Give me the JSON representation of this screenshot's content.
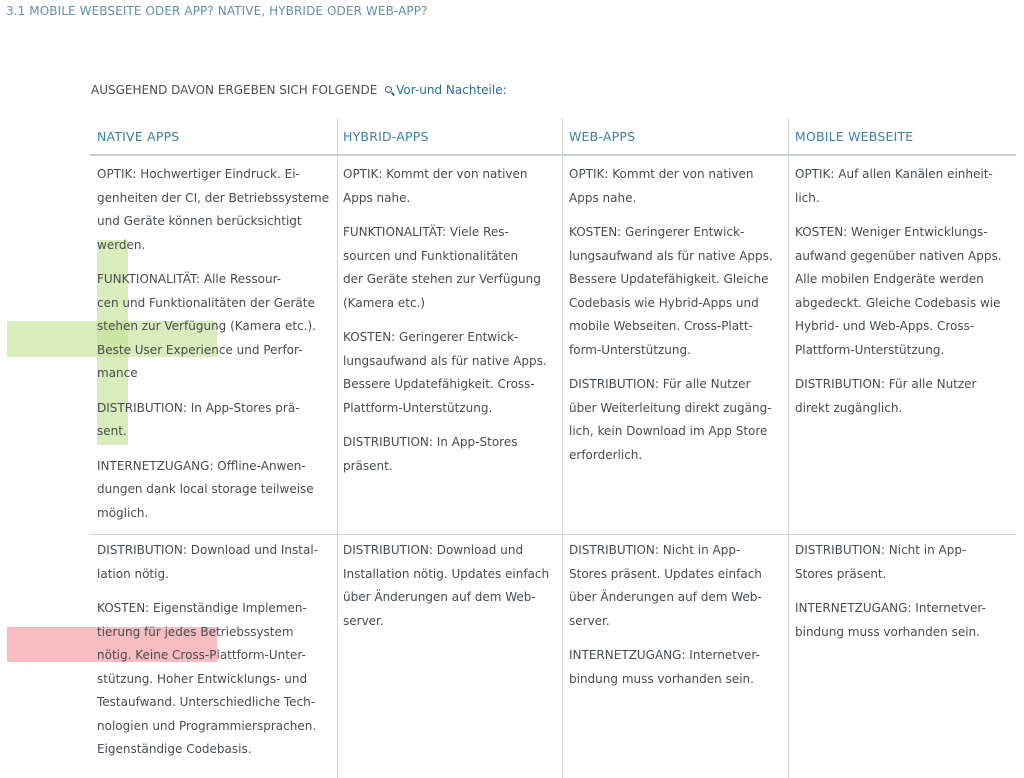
{
  "header": {
    "section_title": "3.1 MOBILE WEBSEITE ODER APP? NATIVE, HYBRIDE ODER WEB-APP?"
  },
  "intro": {
    "text": "AUSGEHEND DAVON ERGEBEN SICH FOLGENDE",
    "link_icon": "magnifier-icon",
    "link_text": "Vor-und Nachteile:"
  },
  "highlight_colors": {
    "green": "#c4e296",
    "red": "#f4a0a4"
  },
  "columns": [
    {
      "title": "NATIVE APPS"
    },
    {
      "title": "HYBRID-APPS"
    },
    {
      "title": "WEB-APPS"
    },
    {
      "title": "MOBILE WEBSEITE"
    }
  ],
  "rows": [
    {
      "cells": [
        [
          "OPTIK: Hochwertiger Eindruck. Ei-\ngenheiten der CI, der Betriebssysteme\nund Geräte können berücksichtigt\nwerden.",
          "FUNKTIONALITÄT: Alle Ressour-\ncen und Funktionalitäten der Geräte\nstehen zur Verfügung (Kamera etc.).\nBeste User Experience und Perfor-\nmance",
          "DISTRIBUTION: In App-Stores prä-\nsent.",
          "INTERNETZUGANG: Offline-Anwen-\ndungen dank local storage teilweise\nmöglich."
        ],
        [
          "OPTIK: Kommt der von nativen\nApps nahe.",
          "FUNKTIONALITÄT: Viele Res-\nsourcen und Funktionalitäten\nder Geräte stehen zur Verfügung\n(Kamera etc.)",
          "KOSTEN: Geringerer Entwick-\nlungsaufwand als für native Apps.\nBessere Updatefähigkeit. Cross-\nPlattform-Unterstützung.",
          "DISTRIBUTION: In App-Stores\npräsent."
        ],
        [
          "OPTIK: Kommt der von nativen\nApps nahe.",
          "KOSTEN: Geringerer Entwick-\nlungsaufwand als für native Apps.\nBessere Updatefähigkeit. Gleiche\nCodebasis wie Hybrid-Apps und\nmobile Webseiten. Cross-Platt-\nform-Unterstützung.",
          "DISTRIBUTION: Für alle Nutzer\nüber Weiterleitung direkt zugäng-\nlich, kein Download im App Store\nerforderlich."
        ],
        [
          "OPTIK: Auf allen Kanälen einheit-\nlich.",
          "KOSTEN: Weniger Entwicklungs-\naufwand gegenüber nativen Apps.\nAlle mobilen Endgeräte werden\nabgedeckt. Gleiche Codebasis wie\nHybrid- und Web-Apps. Cross-\nPlattform-Unterstützung.",
          "DISTRIBUTION: Für alle Nutzer\ndirekt zugänglich."
        ]
      ]
    },
    {
      "cells": [
        [
          "DISTRIBUTION: Download und Instal-\nlation nötig.",
          "KOSTEN: Eigenständige Implemen-\ntierung für jedes Betriebssystem\nnötig. Keine Cross-Plattform-Unter-\nstützung. Hoher Entwicklungs- und\nTestaufwand. Unterschiedliche Tech-\nnologien und Programmiersprachen.\nEigenständige Codebasis."
        ],
        [
          "DISTRIBUTION: Download und\nInstallation nötig. Updates einfach\nüber Änderungen auf dem Web-\nserver."
        ],
        [
          "DISTRIBUTION: Nicht in App-\nStores präsent. Updates einfach\nüber Änderungen auf dem Web-\nserver.",
          "INTERNETZUGANG: Internetver-\nbindung muss vorhanden sein."
        ],
        [
          "DISTRIBUTION: Nicht in App-\nStores präsent.",
          "INTERNETZUGANG: Internetver-\nbindung muss vorhanden sein."
        ]
      ]
    }
  ]
}
